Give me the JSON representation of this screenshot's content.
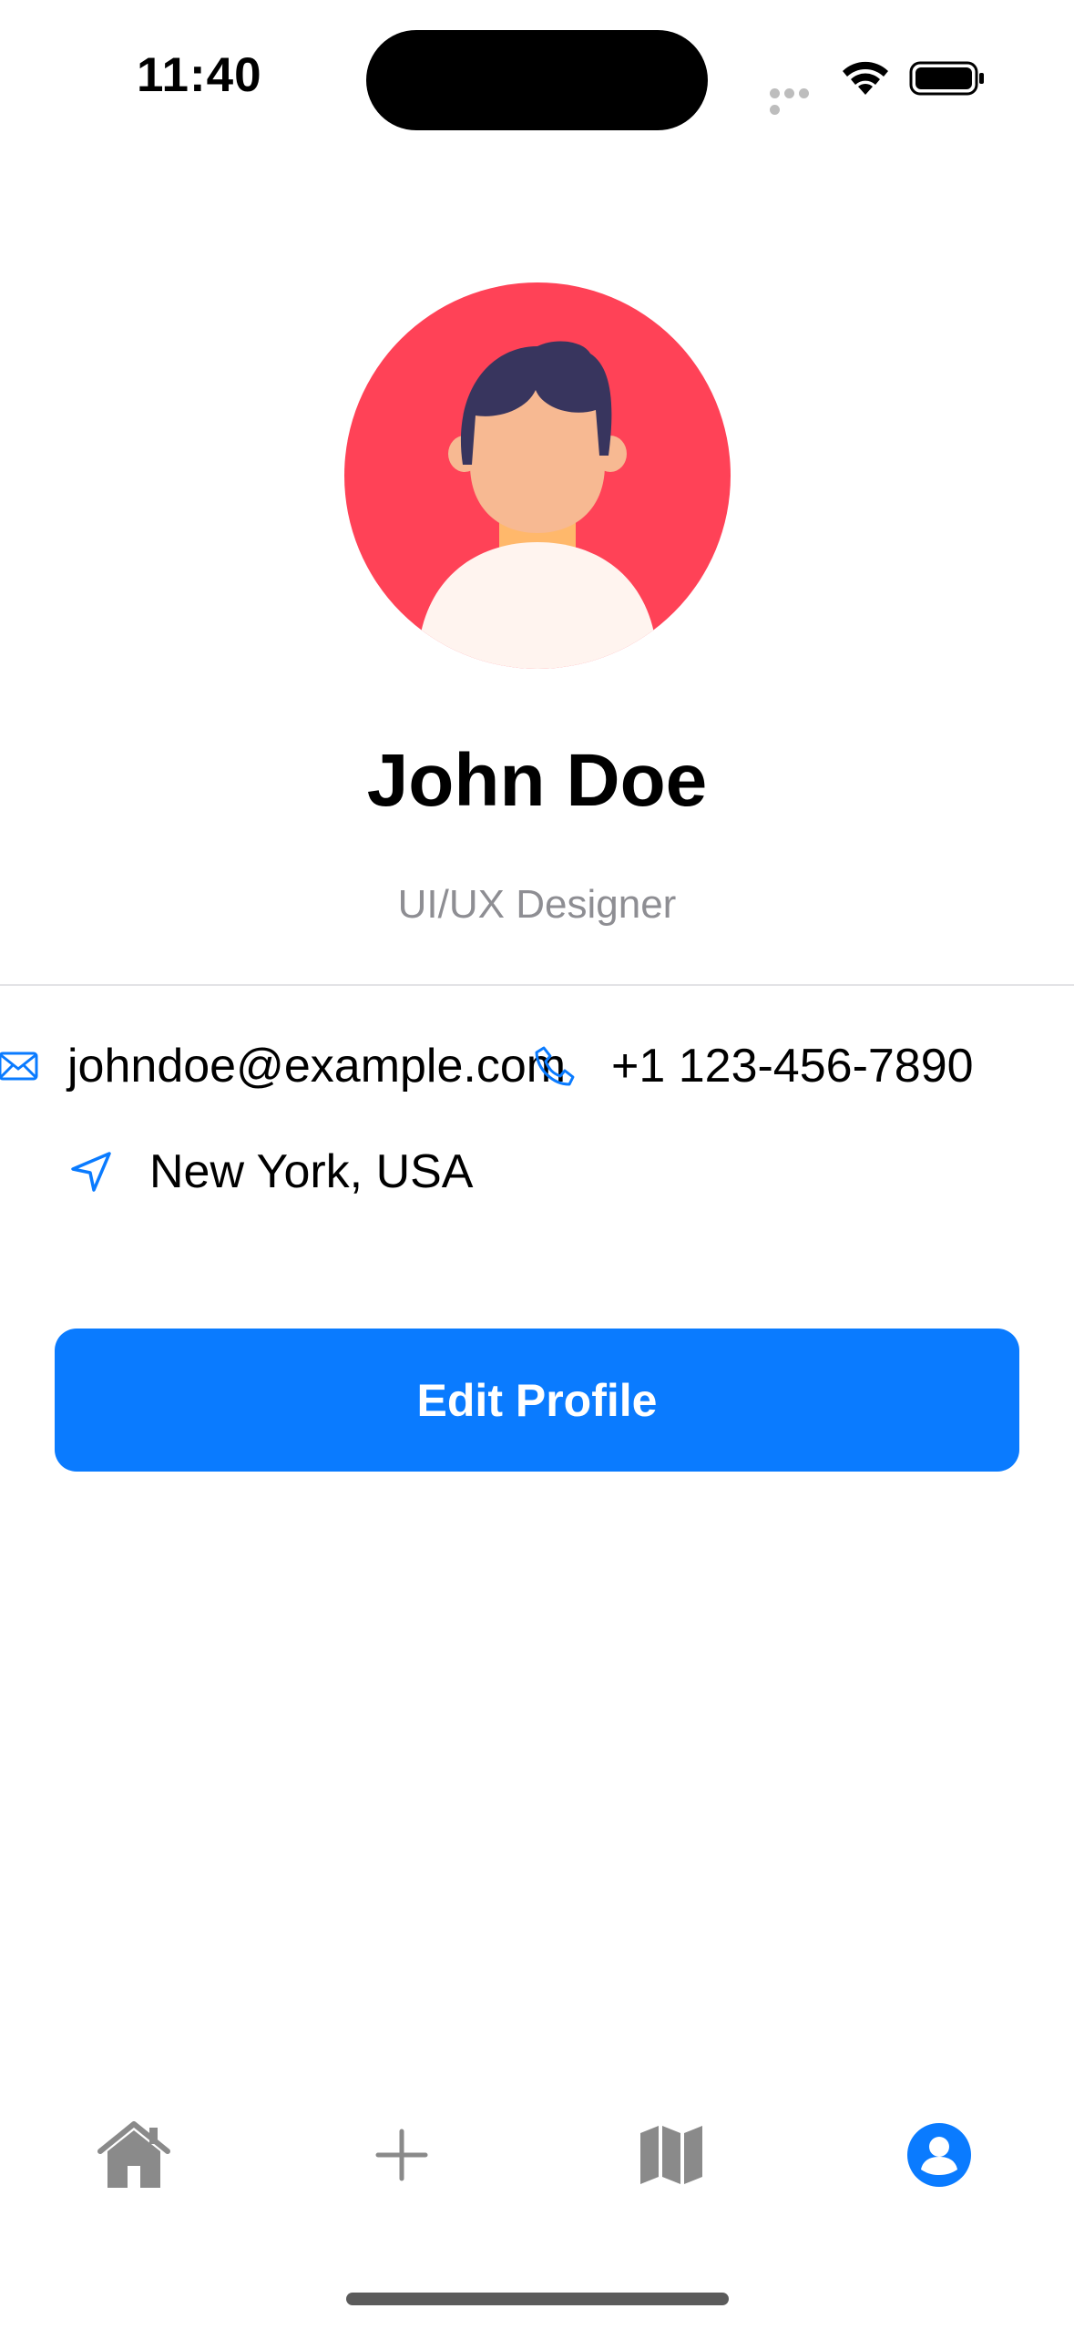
{
  "status_bar": {
    "time": "11:40"
  },
  "profile": {
    "name": "John Doe",
    "role": "UI/UX Designer"
  },
  "contacts": {
    "email": "johndoe@example.com",
    "phone": "+1 123-456-7890",
    "location": "New York, USA"
  },
  "actions": {
    "edit_label": "Edit Profile"
  },
  "tab_bar": {
    "items": [
      {
        "icon": "house-icon",
        "active": false
      },
      {
        "icon": "plus-icon",
        "active": false
      },
      {
        "icon": "map-icon",
        "active": false
      },
      {
        "icon": "person-circle-icon",
        "active": true
      }
    ]
  },
  "colors": {
    "accent": "#0a7bff",
    "avatar_bg": "#ff4257",
    "muted_text": "#8e8e93",
    "inactive_icon": "#8a8a8a"
  }
}
